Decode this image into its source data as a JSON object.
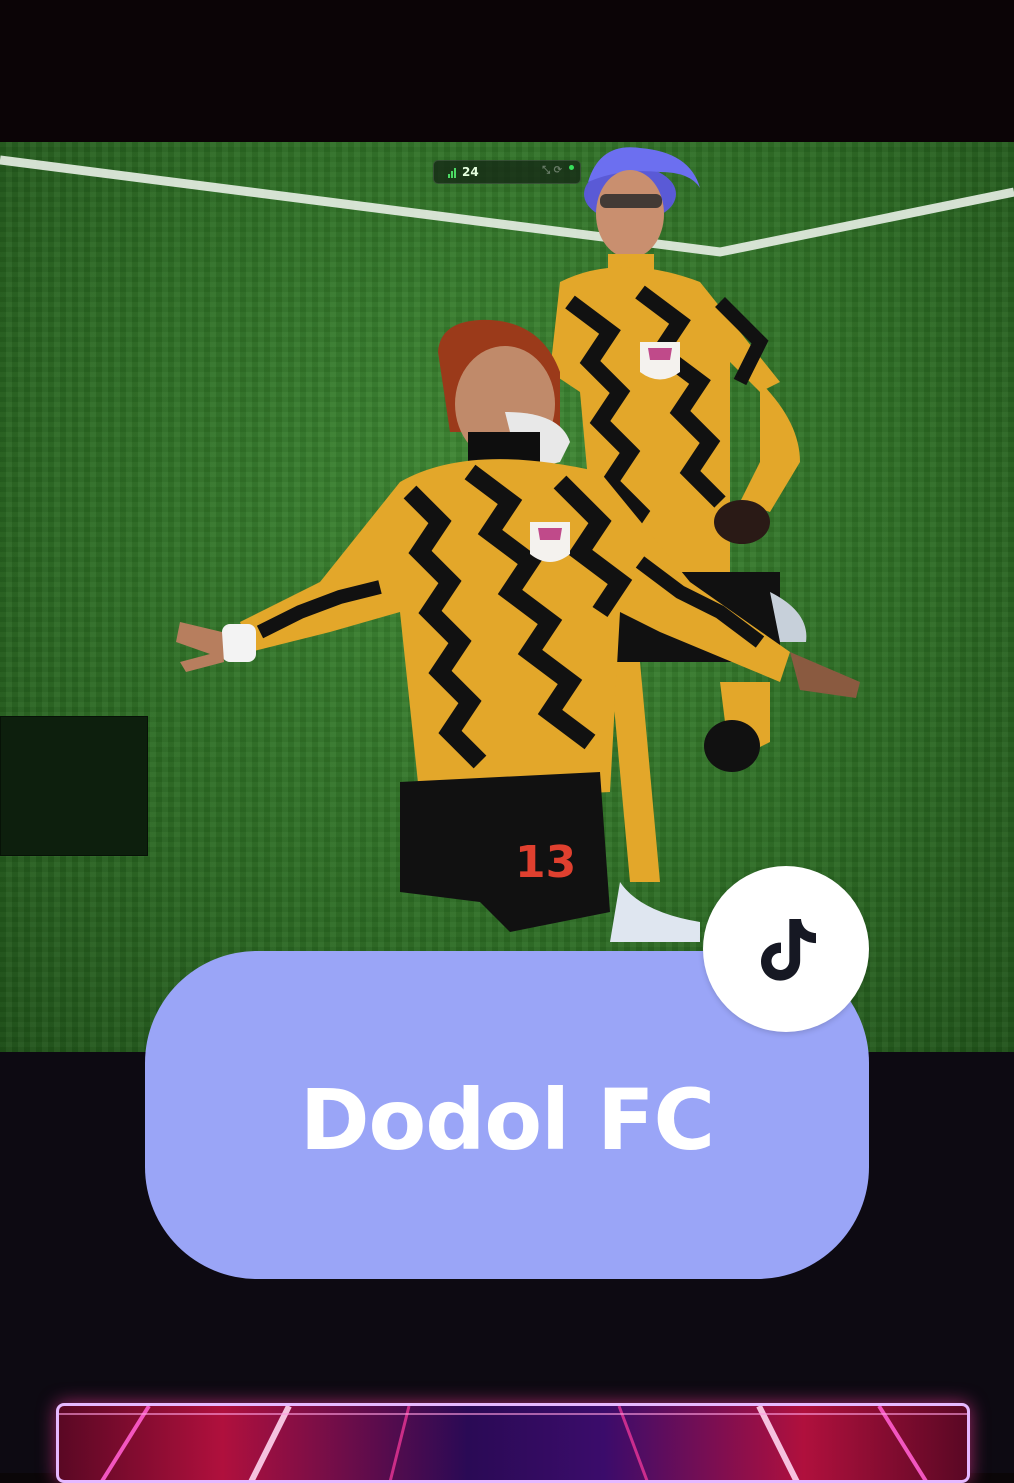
{
  "hud": {
    "ping_value": "24",
    "status_color": "#37e05a"
  },
  "overlay": {
    "title": "Dodol FC",
    "pill_color": "#9aa5f7",
    "logo": "tiktok-logo-icon"
  },
  "players": {
    "kit_colors": {
      "primary": "#e3a72a",
      "secondary": "#111111"
    },
    "front_player_number": "13"
  },
  "colors": {
    "pitch": "#2f7026",
    "neon_accent": "#ff3da0"
  }
}
